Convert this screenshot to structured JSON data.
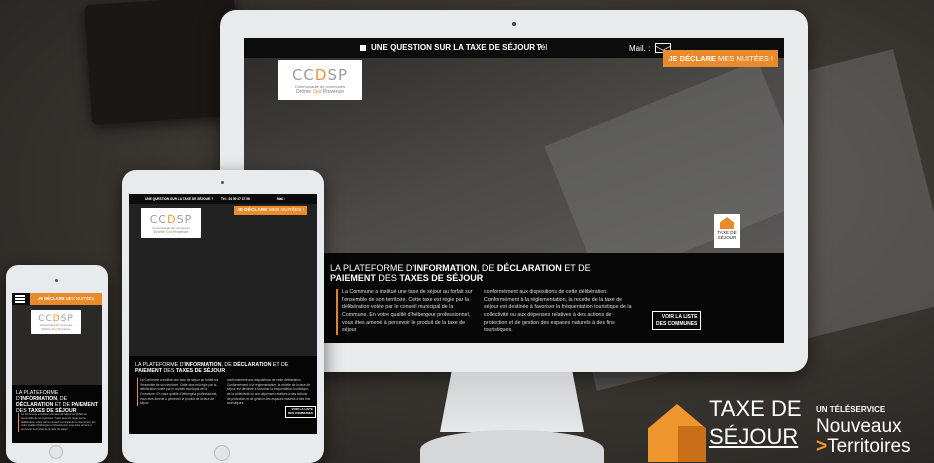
{
  "colors": {
    "accent": "#e98a2b",
    "dark_band": "#070707",
    "device": "#e9eaec"
  },
  "desktop": {
    "topbar": {
      "question": "UNE QUESTION SUR LA TAXE DE SÉJOUR ?",
      "tel_label": "Tél",
      "mail_label": "Mail. :",
      "mail_icon": "envelope-icon"
    },
    "declare_strong": "JE DÉCLARE",
    "declare_rest": " MES NUITÉES !",
    "logo": {
      "mark_a": "CC",
      "mark_o": "D",
      "mark_b": "SP",
      "sub1": "Communauté de communes",
      "sub2_a": "Drôme ",
      "sub2_acc": "Sud",
      "sub2_b": " Provence"
    },
    "badge": {
      "line1": "TAXE DE",
      "line2": "SÉJOUR"
    },
    "headline": {
      "p1": "LA PLATEFORME D'",
      "b1": "INFORMATION",
      "p2": ", DE ",
      "b2": "DÉCLARATION",
      "p3": " ET DE ",
      "b3": "PAIEMENT",
      "p4": " DES ",
      "b4": "TAXES DE SÉJOUR"
    },
    "col1": "La Commune a institué une taxe de séjour au forfait sur l'ensemble de son territoire. Cette taxe est régie par la délibération votée par le conseil municipal de la Commune. En votre qualité d'hébergeur professionnel, vous êtes amené à percevoir le produit de la taxe de séjour",
    "col2": "conformément aux dispositions de cette délibération. Conformément à la réglementation, la recette de la taxe de séjour est destinée à favoriser la fréquentation touristique de la collectivité ou aux dépenses relatives à des actions de protection et de gestion des espaces naturels à des fins touristiques.",
    "liste_1": "VOIR LA LISTE",
    "liste_2": "DES COMMUNES"
  },
  "tablet": {
    "topbar_q": "UNE QUESTION SUR LA TAXE DE SÉJOUR ?",
    "topbar_tel": "Tél : 04 50 47 37 58",
    "topbar_mail": "Mail :",
    "declare_strong": "JE DÉCLARE",
    "declare_rest": " MES NUITÉES !"
  },
  "phone": {
    "declare_strong": "JE DÉCLARE",
    "declare_rest": " MES NUITÉES"
  },
  "brand": {
    "taxe": "TAXE DE",
    "sejour": "SÉJOUR",
    "teleservice": "UN TÉLÉSERVICE",
    "nouveaux": "Nouveaux",
    "arrow": ">",
    "territoires": "Territoires"
  }
}
